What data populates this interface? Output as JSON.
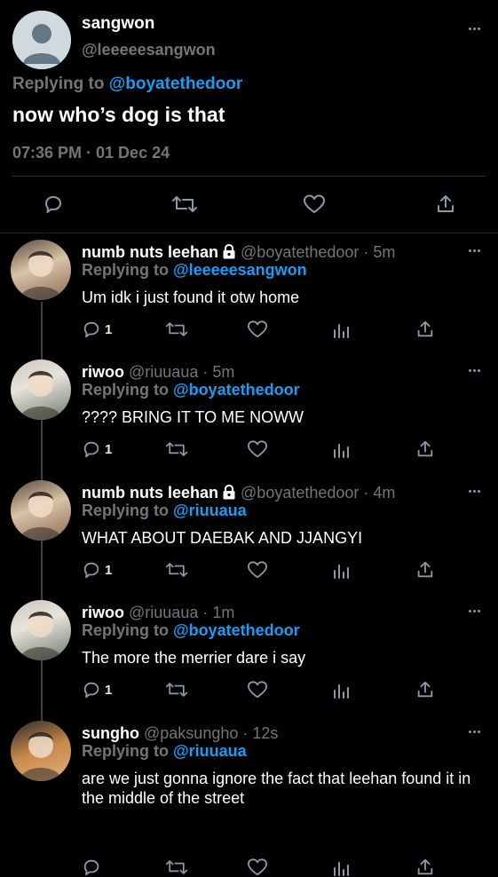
{
  "main_tweet": {
    "name": "sangwon",
    "handle": "@leeeeesangwon",
    "replying_prefix": "Replying to",
    "replying_handle": "@boyatethedoor",
    "text": "now who’s dog is that",
    "timestamp": "07:36 PM · 01 Dec 24",
    "icons": [
      "reply-icon",
      "retweet-icon",
      "like-icon",
      "share-icon"
    ]
  },
  "replies": [
    {
      "name": "numb nuts leehan",
      "locked": true,
      "handle": "@boyatethedoor",
      "time": "· 5m",
      "replying_prefix": "Replying to",
      "replying_handle": "@leeeeesangwon",
      "text": "Um idk i just found it otw home",
      "reply_count": "1"
    },
    {
      "name": "riwoo",
      "locked": false,
      "handle": "@riuuaua",
      "time": "· 5m",
      "replying_prefix": "Replying to",
      "replying_handle": "@boyatethedoor",
      "text": "???? BRING IT TO ME NOWW",
      "reply_count": "1"
    },
    {
      "name": "numb nuts leehan",
      "locked": true,
      "handle": "@boyatethedoor",
      "time": "· 4m",
      "replying_prefix": "Replying to",
      "replying_handle": "@riuuaua",
      "text": "WHAT ABOUT DAEBAK AND JJANGYI",
      "reply_count": "1"
    },
    {
      "name": "riwoo",
      "locked": false,
      "handle": "@riuuaua",
      "time": "· 1m",
      "replying_prefix": "Replying to",
      "replying_handle": "@boyatethedoor",
      "text": "The more the merrier dare i say",
      "reply_count": "1"
    },
    {
      "name": "sungho",
      "locked": false,
      "handle": "@paksungho",
      "time": "· 12s",
      "replying_prefix": "Replying to",
      "replying_handle": "@riuuaua",
      "text": "are we just gonna ignore the fact that leehan found it in the middle of the street",
      "reply_count": ""
    }
  ],
  "colors": {
    "background": "#000000",
    "accent": "#1d9bf0",
    "muted": "#71767b",
    "text": "#e7e9ea"
  }
}
